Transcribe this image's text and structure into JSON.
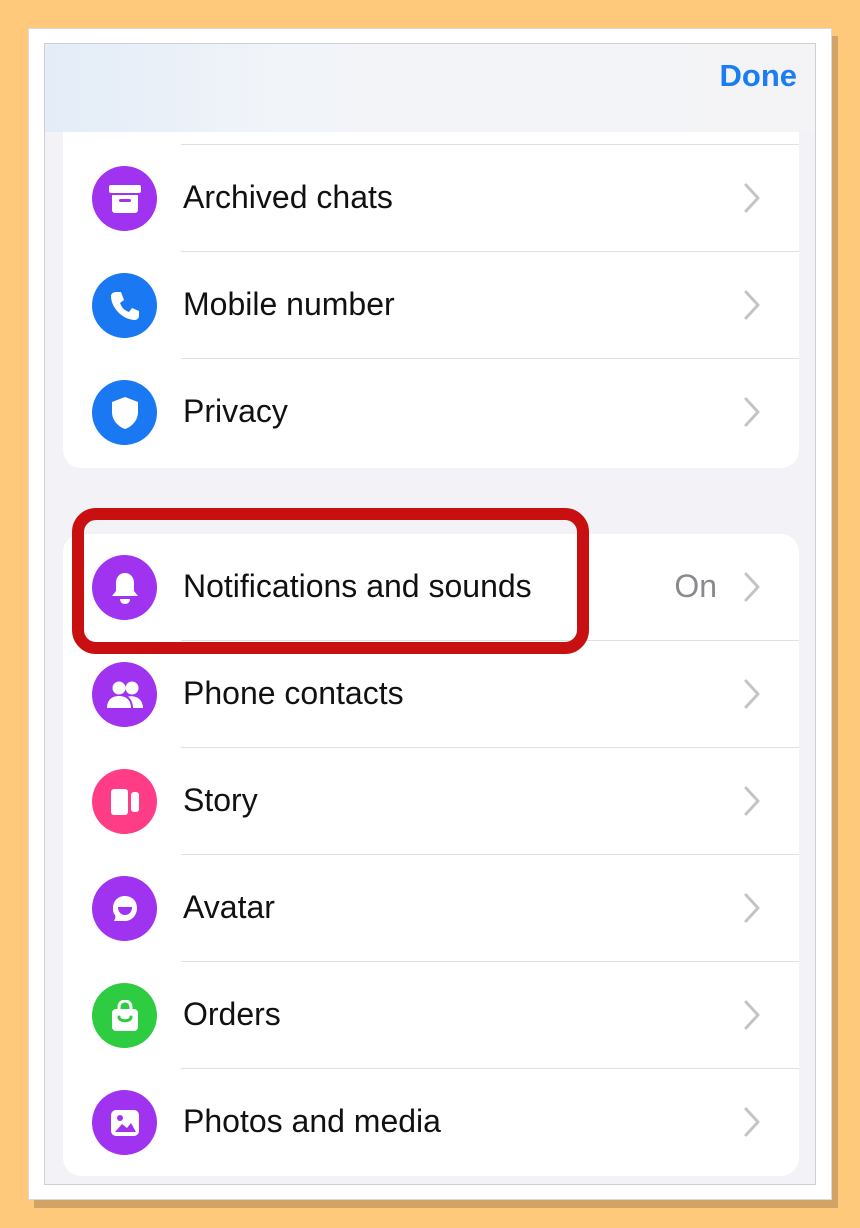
{
  "navbar": {
    "done_label": "Done"
  },
  "group1": {
    "items": [
      {
        "label": "Archived chats",
        "icon": "archive-icon",
        "color": "#a033f0"
      },
      {
        "label": "Mobile number",
        "icon": "phone-icon",
        "color": "#1a78f2"
      },
      {
        "label": "Privacy",
        "icon": "shield-icon",
        "color": "#1a78f2"
      }
    ]
  },
  "group2": {
    "items": [
      {
        "label": "Notifications and sounds",
        "value": "On",
        "icon": "bell-icon",
        "color": "#a033f0"
      },
      {
        "label": "Phone contacts",
        "icon": "people-icon",
        "color": "#a033f0"
      },
      {
        "label": "Story",
        "icon": "story-icon",
        "color": "#ff3d86"
      },
      {
        "label": "Avatar",
        "icon": "avatar-icon",
        "color": "#a033f0"
      },
      {
        "label": "Orders",
        "icon": "shopping-bag-icon",
        "color": "#2ecc40"
      },
      {
        "label": "Photos and media",
        "icon": "photo-icon",
        "color": "#a033f0"
      }
    ]
  },
  "colors": {
    "accent": "#1b7cf3",
    "highlight": "#c81010",
    "background": "#ffc97c"
  }
}
